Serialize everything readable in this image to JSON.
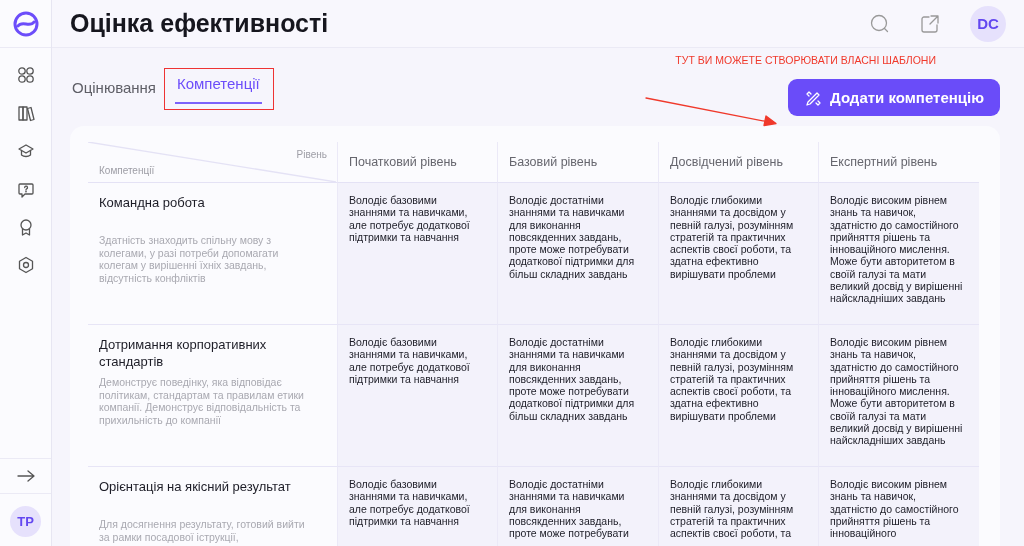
{
  "sidebar": {
    "nav": [
      {
        "kind": "grid"
      },
      {
        "kind": "books"
      },
      {
        "kind": "cap"
      },
      {
        "kind": "question"
      },
      {
        "kind": "award"
      },
      {
        "kind": "hexagon"
      }
    ],
    "user_initials": "TP"
  },
  "header": {
    "title": "Оцінка ефективності",
    "user_initials": "DC"
  },
  "tabs": [
    {
      "label": "Оцінювання",
      "selected": false,
      "highlighted": false
    },
    {
      "label": "Компетенції",
      "selected": true,
      "highlighted": true
    }
  ],
  "annotation": {
    "text": "ТУТ ВИ МОЖЕТЕ СТВОРЮВАТИ ВЛАСНІ ШАБЛОНИ"
  },
  "add_button": {
    "label": "Додати компетенцію"
  },
  "table": {
    "corner_top": "Рівень",
    "corner_bottom": "Компетенції",
    "columns": [
      "Початковий рівень",
      "Базовий рівень",
      "Досвідчений рівень",
      "Експертний рівень"
    ],
    "rows": [
      {
        "name": "Командна робота",
        "description": "Здатність знаходить спільну мову з колегами, у разі потреби допомагати колегам у вирішенні їхніх завдань, відсутність конфліктів",
        "cells": [
          "Володіє базовими знаннями та навичками, але потребує додаткової підтримки та навчання",
          "Володіє достатніми знаннями та навичками для виконання повсякденних завдань, проте може потребувати додаткової підтримки для більш складних завдань",
          "Володіє глибокими знаннями та досвідом у певній галузі, розумінням стратегій та практичних аспектів своєї роботи, та здатна ефективно вирішувати проблеми",
          "Володіє високим рівнем знань та навичок, здатністю до самостійного прийняття рішень та інноваційного мислення. Може бути авторитетом в своїй галузі та мати великий досвід у вирішенні найскладніших завдань"
        ]
      },
      {
        "name": "Дотримання корпоративних стандартів",
        "description": "Демонструє поведінку, яка відповідає політикам, стандартам та правилам етики компанії. Демонструє відповідальність та прихильність до компанії",
        "cells": [
          "Володіє базовими знаннями та навичками, але потребує додаткової підтримки та навчання",
          "Володіє достатніми знаннями та навичками для виконання повсякденних завдань, проте може потребувати додаткової підтримки для більш складних завдань",
          "Володіє глибокими знаннями та досвідом у певній галузі, розумінням стратегій та практичних аспектів своєї роботи, та здатна ефективно вирішувати проблеми",
          "Володіє високим рівнем знань та навичок, здатністю до самостійного прийняття рішень та інноваційного мислення. Може бути авторитетом в своїй галузі та мати великий досвід у вирішенні найскладніших завдань"
        ]
      },
      {
        "name": "Орієнтація на якісний результат",
        "description": "Для досягнення результату, готовий вийти за рамки посадової іструкції,",
        "cells": [
          "Володіє базовими знаннями та навичками, але потребує додаткової підтримки та навчання",
          "Володіє достатніми знаннями та навичками для виконання повсякденних завдань, проте може потребувати",
          "Володіє глибокими знаннями та досвідом у певній галузі, розумінням стратегій та практичних аспектів своєї роботи, та",
          "Володіє високим рівнем знань та навичок, здатністю до самостійного прийняття рішень та інноваційного"
        ]
      }
    ]
  }
}
